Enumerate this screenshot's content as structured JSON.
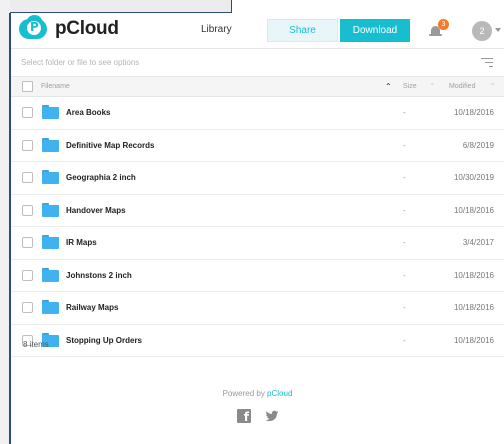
{
  "app": {
    "logo_text": "pCloud",
    "logo_letter": "P"
  },
  "header": {
    "library_label": "Library",
    "share_label": "Share",
    "download_label": "Download",
    "notification_count": "3",
    "avatar_initial": "2"
  },
  "toolbar": {
    "selection_hint": "Select folder or file to see options"
  },
  "table": {
    "columns": {
      "filename": "Filename",
      "size": "Size",
      "modified": "Modified"
    },
    "rows": [
      {
        "name": "Area Books",
        "size": "-",
        "modified": "10/18/2016"
      },
      {
        "name": "Definitive Map Records",
        "size": "-",
        "modified": "6/8/2019"
      },
      {
        "name": "Geographia 2 inch",
        "size": "-",
        "modified": "10/30/2019"
      },
      {
        "name": "Handover Maps",
        "size": "-",
        "modified": "10/18/2016"
      },
      {
        "name": "IR Maps",
        "size": "-",
        "modified": "3/4/2017"
      },
      {
        "name": "Johnstons 2 inch",
        "size": "-",
        "modified": "10/18/2016"
      },
      {
        "name": "Railway Maps",
        "size": "-",
        "modified": "10/18/2016"
      },
      {
        "name": "Stopping Up Orders",
        "size": "-",
        "modified": "10/18/2016"
      }
    ],
    "items_count": "8 items"
  },
  "footer": {
    "powered_prefix": "Powered by ",
    "powered_link": "pCloud",
    "facebook_glyph": "f"
  },
  "colors": {
    "accent": "#17bed0",
    "folder": "#40b2ef",
    "badge": "#f07b2a"
  }
}
